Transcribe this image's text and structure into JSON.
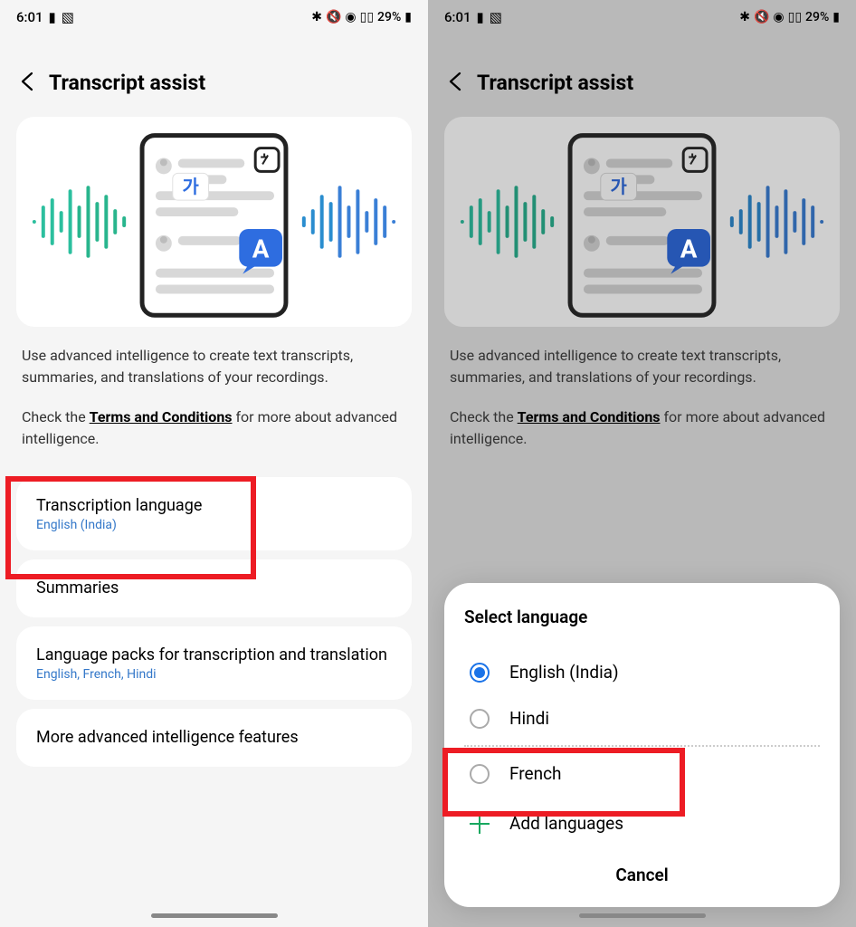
{
  "status": {
    "time": "6:01",
    "battery_text": "29%"
  },
  "header": {
    "title": "Transcript assist"
  },
  "description": {
    "line1": "Use advanced intelligence to create text transcripts, summaries, and translations of your recordings.",
    "line2_pre": "Check the ",
    "terms": "Terms and Conditions",
    "line2_post": " for more about advanced intelligence."
  },
  "options": {
    "transcription": {
      "title": "Transcription language",
      "sub": "English (India)"
    },
    "summaries": {
      "title": "Summaries"
    },
    "packs": {
      "title": "Language packs for transcription and translation",
      "sub": "English, French, Hindi"
    },
    "more": {
      "title": "More advanced intelligence features"
    }
  },
  "dialog": {
    "title": "Select language",
    "languages": {
      "english": "English (India)",
      "hindi": "Hindi",
      "french": "French"
    },
    "add": "Add languages",
    "cancel": "Cancel"
  }
}
